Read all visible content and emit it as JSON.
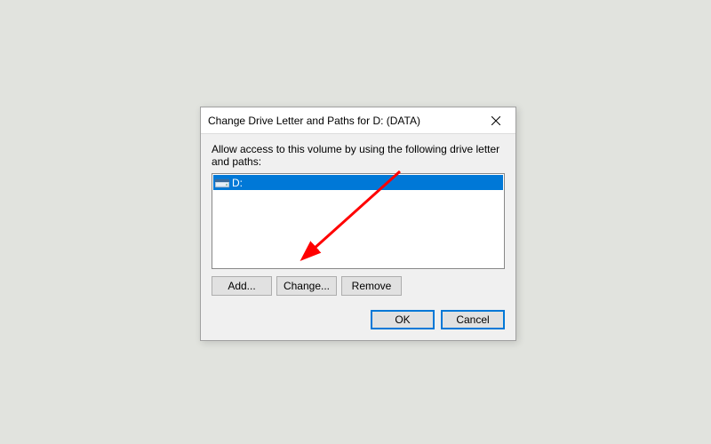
{
  "dialog": {
    "title": "Change Drive Letter and Paths for D: (DATA)",
    "instruction": "Allow access to this volume by using the following drive letter and paths:",
    "list": {
      "items": [
        {
          "icon": "drive-icon",
          "label": "D:",
          "selected": true
        }
      ]
    },
    "buttons": {
      "add": "Add...",
      "change": "Change...",
      "remove": "Remove"
    },
    "actions": {
      "ok": "OK",
      "cancel": "Cancel"
    }
  },
  "annotation": {
    "arrow_color": "#ff0000",
    "target": "change-button"
  }
}
